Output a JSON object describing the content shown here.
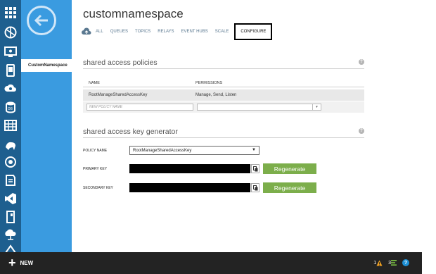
{
  "rail": {
    "icons": [
      "all-items-icon",
      "web-sites-icon",
      "virtual-machines-icon",
      "mobile-services-icon",
      "cloud-services-icon",
      "sql-databases-icon",
      "storage-icon",
      "hdinsight-icon",
      "media-services-icon",
      "service-bus-icon",
      "visual-studio-icon",
      "cache-icon",
      "networks-icon",
      "traffic-manager-icon"
    ]
  },
  "sidebar": {
    "item": "CustomNamespace"
  },
  "header": {
    "title": "customnamespace",
    "tabs": [
      {
        "label": "ALL"
      },
      {
        "label": "QUEUES"
      },
      {
        "label": "TOPICS"
      },
      {
        "label": "RELAYS"
      },
      {
        "label": "EVENT HUBS"
      },
      {
        "label": "SCALE"
      },
      {
        "label": "CONFIGURE"
      }
    ],
    "active_tab": "CONFIGURE"
  },
  "policies": {
    "section_title": "shared access policies",
    "help": "?",
    "columns": [
      "NAME",
      "PERMISSIONS"
    ],
    "rows": [
      {
        "name": "RootManageSharedAccessKey",
        "permissions": "Manage, Send, Listen"
      }
    ],
    "new_name_placeholder": "NEW POLICY NAME",
    "new_permissions_value": ""
  },
  "generator": {
    "section_title": "shared access key generator",
    "help": "?",
    "policy_label": "POLICY NAME",
    "policy_value": "RootManageSharedAccessKey",
    "primary_label": "PRIMARY KEY",
    "secondary_label": "SECONDARY KEY",
    "regenerate_label": "Regenerate"
  },
  "bottom": {
    "new_label": "NEW",
    "warning_count": "1",
    "list_count": "3",
    "help": "?"
  },
  "colors": {
    "rail": "#1e5f8f",
    "sidebar": "#3a9be0",
    "regenerate": "#7cae4b",
    "bottom_bar": "#232323"
  }
}
